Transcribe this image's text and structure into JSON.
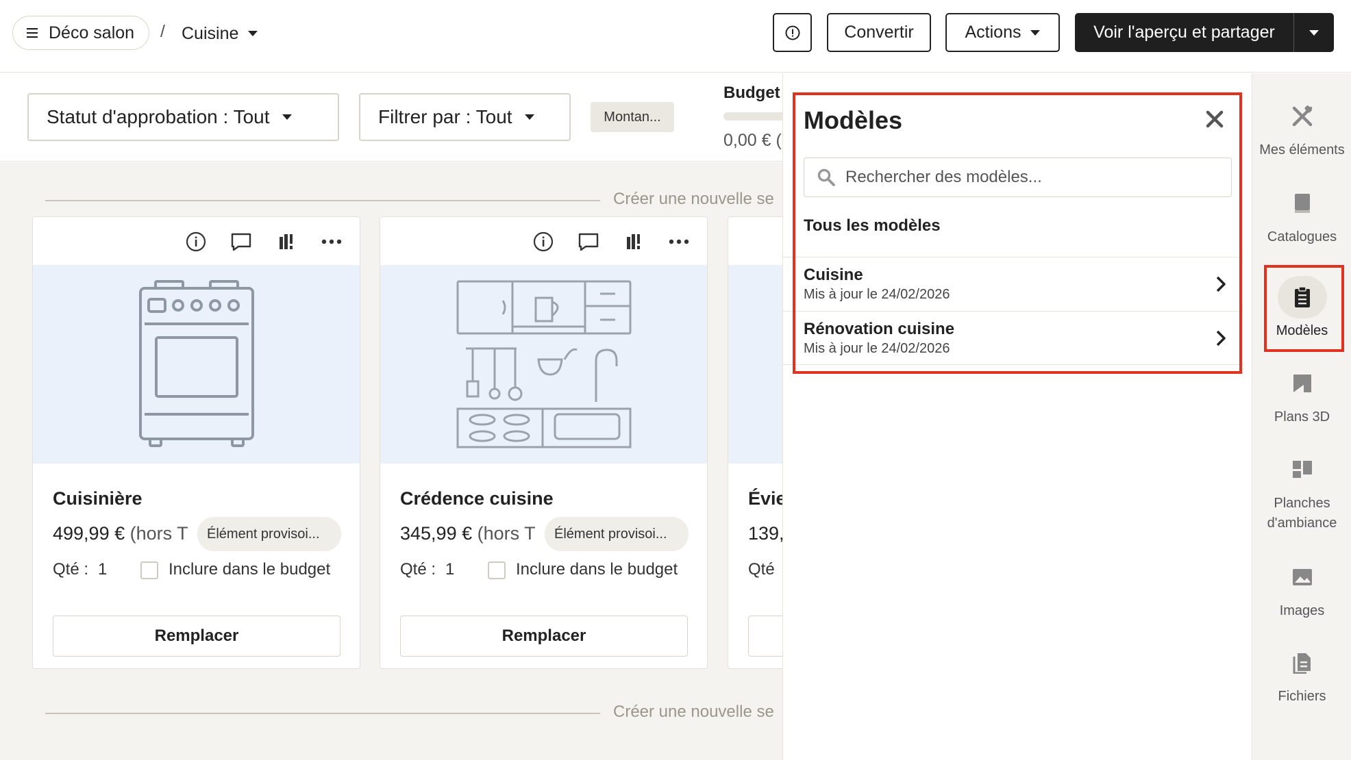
{
  "header": {
    "project_name": "Déco salon",
    "separator": "/",
    "room_name": "Cuisine",
    "convert_label": "Convertir",
    "actions_label": "Actions",
    "share_label": "Voir l'aperçu et partager"
  },
  "filters": {
    "approval_status": "Statut d'approbation : Tout",
    "filter_by": "Filtrer par : Tout",
    "amount_chip": "Montan...",
    "budget_label": "Budget",
    "budget_value": "0,00 € (",
    "budget_progress": 0
  },
  "main": {
    "section_label": "Créer une nouvelle se",
    "cards": [
      {
        "title": "Cuisinière",
        "price": "499,99 €",
        "price_suffix": " (hors T",
        "badge": "Élément provisoi...",
        "qty_label": "Qté :",
        "qty_value": "1",
        "include_label": "Inclure dans le budget",
        "replace_label": "Remplacer",
        "illustration": "stove-icon"
      },
      {
        "title": "Crédence cuisine",
        "price": "345,99 €",
        "price_suffix": " (hors T",
        "badge": "Élément provisoi...",
        "qty_label": "Qté :",
        "qty_value": "1",
        "include_label": "Inclure dans le budget",
        "replace_label": "Remplacer",
        "illustration": "kitchen-backsplash-icon"
      },
      {
        "title": "Évie",
        "price": "139,",
        "qty_label": "Qté"
      }
    ]
  },
  "panel": {
    "title": "Modèles",
    "search_placeholder": "Rechercher des modèles...",
    "section_title": "Tous les modèles",
    "templates": [
      {
        "name": "Cuisine",
        "date": "Mis à jour le 24/02/2026"
      },
      {
        "name": "Rénovation cuisine",
        "date": "Mis à jour le 24/02/2026"
      }
    ]
  },
  "rail": {
    "items": [
      {
        "label": "Mes éléments",
        "icon": "tools-icon"
      },
      {
        "label": "Catalogues",
        "icon": "book-icon"
      },
      {
        "label": "Modèles",
        "icon": "clipboard-icon",
        "active": true
      },
      {
        "label": "Plans 3D",
        "icon": "floorplan-icon"
      },
      {
        "label": "Planches d'ambiance",
        "icon": "moodboard-icon"
      },
      {
        "label": "Images",
        "icon": "image-icon"
      },
      {
        "label": "Fichiers",
        "icon": "files-icon"
      }
    ]
  },
  "colors": {
    "highlight": "#e0321f",
    "dark_button": "#1f1f1f",
    "card_image_bg": "#eaf1fb",
    "page_bg": "#f5f3ef"
  }
}
